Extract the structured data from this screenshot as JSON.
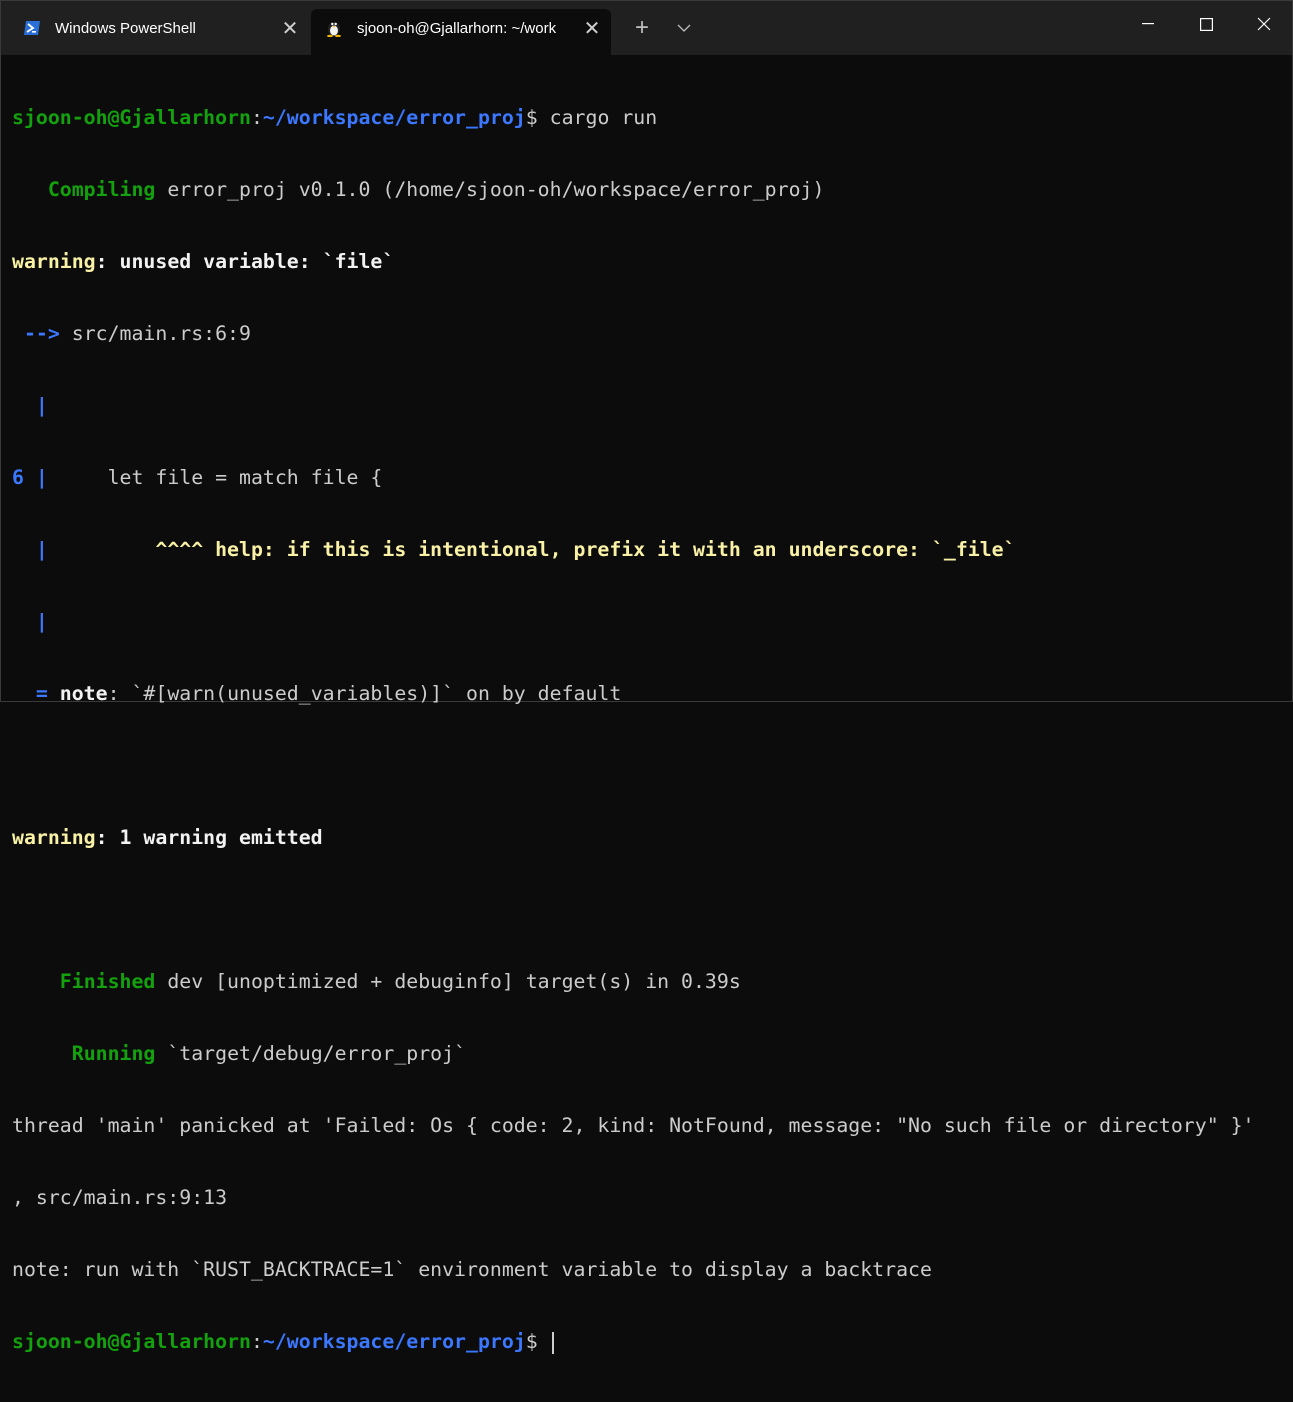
{
  "tabs": [
    {
      "title": "Windows PowerShell",
      "icon": "powershell-icon",
      "active": false
    },
    {
      "title": "sjoon-oh@Gjallarhorn: ~/work",
      "icon": "linux-tux-icon",
      "active": true
    }
  ],
  "window_controls": {
    "minimize": "minimize-icon",
    "maximize": "maximize-icon",
    "close": "close-icon"
  },
  "colors": {
    "green": "#13a10e",
    "blue": "#3b78ff",
    "yellow": "#f9f1a5",
    "text": "#cccccc",
    "background": "#0c0c0c",
    "tabbar": "#202020"
  },
  "terminal": {
    "l1": {
      "user": "sjoon-oh@Gjallarhorn",
      "sep": ":",
      "path": "~/workspace/error_proj",
      "prompt": "$ ",
      "command": "cargo run"
    },
    "l2": {
      "indent": "   ",
      "keyword": "Compiling",
      "text": " error_proj v0.1.0 (/home/sjoon-oh/workspace/error_proj)"
    },
    "l3": {
      "keyword": "warning",
      "text": ": unused variable: `file`"
    },
    "l4": {
      "arrow": " -->",
      "text": " src/main.rs:6:9"
    },
    "l5": {
      "gutter": "  |"
    },
    "l6": {
      "lineno": "6",
      "gutter": " |",
      "code": "     let file = match file {"
    },
    "l7": {
      "gutter": "  |",
      "pad": "         ",
      "hint": "^^^^ help: if this is intentional, prefix it with an underscore: `_file`"
    },
    "l8": {
      "gutter": "  |"
    },
    "l9": {
      "eq": "  =",
      "label": " note",
      "text": ": `#[warn(unused_variables)]` on by default"
    },
    "l10": {
      "text": ""
    },
    "l11": {
      "keyword": "warning",
      "text": ": 1 warning emitted"
    },
    "l12": {
      "text": ""
    },
    "l13": {
      "indent": "    ",
      "keyword": "Finished",
      "text": " dev [unoptimized + debuginfo] target(s) in 0.39s"
    },
    "l14": {
      "indent": "     ",
      "keyword": "Running",
      "text": " `target/debug/error_proj`"
    },
    "l15": {
      "text": "thread 'main' panicked at 'Failed: Os { code: 2, kind: NotFound, message: \"No such file or directory\" }'"
    },
    "l16": {
      "text": ", src/main.rs:9:13"
    },
    "l17": {
      "text": "note: run with `RUST_BACKTRACE=1` environment variable to display a backtrace"
    },
    "l18": {
      "user": "sjoon-oh@Gjallarhorn",
      "sep": ":",
      "path": "~/workspace/error_proj",
      "prompt": "$ "
    }
  }
}
